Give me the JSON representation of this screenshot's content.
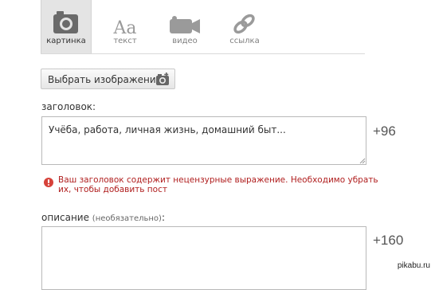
{
  "tabs": [
    {
      "label": "картинка",
      "icon": "camera-icon",
      "active": true
    },
    {
      "label": "текст",
      "icon": "text-icon",
      "active": false
    },
    {
      "label": "видео",
      "icon": "video-camera-icon",
      "active": false
    },
    {
      "label": "ссылка",
      "icon": "link-icon",
      "active": false
    }
  ],
  "pick_image": {
    "label": "Выбрать изображение",
    "icon": "camera-icon"
  },
  "title_field": {
    "label": "заголовок:",
    "placeholder": "Учёба, работа, личная жизнь, домашний быт...",
    "counter": "+96"
  },
  "error": {
    "icon": "error-icon",
    "text": "Ваш заголовок содержит нецензурные выражение. Необходимо убрать их, чтобы добавить пост"
  },
  "description_field": {
    "label": "описание",
    "optional": "(необязательно)",
    "colon": ":",
    "counter": "+160"
  },
  "watermark": "pikabu.ru",
  "colors": {
    "error": "#b01e1e",
    "active_tab": "#e4e4e4",
    "error_icon": "#d6423a"
  }
}
